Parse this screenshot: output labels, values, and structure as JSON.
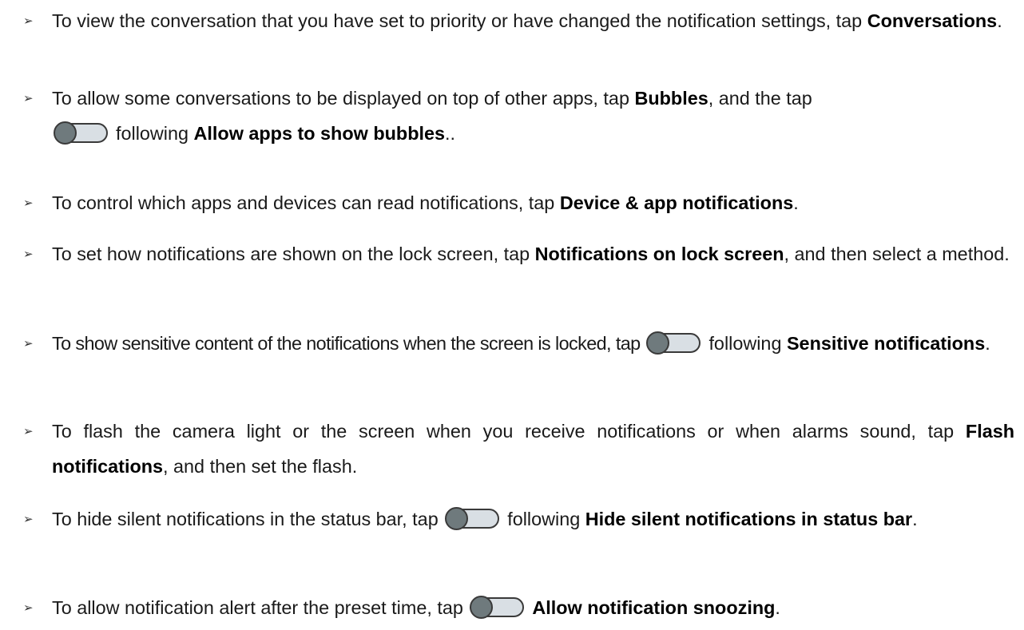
{
  "bullet_glyph": "➢",
  "items": [
    {
      "p1": "To view the conversation that you have set to priority or have changed the notification settings, tap ",
      "b1": "Conversations",
      "p2": "."
    },
    {
      "p1": "To allow some conversations to be displayed on top of other apps, tap ",
      "b1": "Bubbles",
      "p2": ", and the tap ",
      "toggle_icon": "toggle-off-icon",
      "p3": "following ",
      "b2": "Allow apps to show bubbles",
      "p4": ".."
    },
    {
      "p1": "To control which apps and devices can read notifications, tap ",
      "b1": "Device & app notifications",
      "p2": "."
    },
    {
      "p1": "To set how notifications are shown on the lock screen, tap ",
      "b1": "Notifications on lock screen",
      "p2": ", and then select a method."
    },
    {
      "p1": "To show sensitive content of the notifications when the screen is locked, tap ",
      "toggle_icon": "toggle-off-icon",
      "p2": "following ",
      "b1": "Sensitive notifications",
      "p3": "."
    },
    {
      "p1": "To flash the camera light or the screen when you receive notifications or when alarms sound, tap ",
      "b1": "Flash notifications",
      "p2": ", and then set the flash."
    },
    {
      "p1": "To hide silent notifications in the status bar, tap ",
      "toggle_icon": "toggle-off-icon",
      "p2": "following ",
      "b1": "Hide silent notifications in status bar",
      "p3": "."
    },
    {
      "p1": "To allow notification alert after the preset time, tap ",
      "toggle_icon": "toggle-off-icon",
      "b1": "Allow notification snoozing",
      "p2": "."
    }
  ]
}
